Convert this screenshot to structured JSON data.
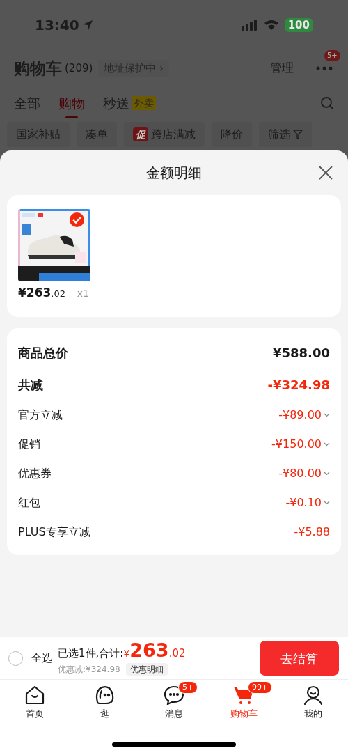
{
  "status_bar": {
    "time": "13:40",
    "battery": "100"
  },
  "header": {
    "title": "购物车",
    "count": "(209)",
    "address_badge": "地址保护中 ›",
    "manage": "管理",
    "more_badge": "5+"
  },
  "tabs": [
    {
      "label": "全部",
      "selected": false
    },
    {
      "label": "购物",
      "selected": true
    },
    {
      "label": "秒送",
      "selected": false,
      "tag": "外卖"
    }
  ],
  "filters": [
    {
      "label": "国家补贴"
    },
    {
      "label": "凑单"
    },
    {
      "label": "跨店满减",
      "tag": "促"
    },
    {
      "label": "降价"
    },
    {
      "label": "筛选",
      "kind": "filter"
    }
  ],
  "sheet": {
    "title": "金额明细",
    "products": [
      {
        "kind": "picture",
        "selected": true,
        "price_main": "¥263",
        "price_decimal": ".02",
        "quantity": "x1"
      }
    ],
    "details": [
      {
        "kind": "total",
        "label": "商品总价",
        "value": "¥588.00"
      },
      {
        "kind": "reduction_total",
        "label": "共减",
        "value": "-¥324.98"
      },
      {
        "kind": "item",
        "label": "官方立减",
        "value": "-¥89.00",
        "expandable": true
      },
      {
        "kind": "item",
        "label": "促销",
        "value": "-¥150.00",
        "expandable": true
      },
      {
        "kind": "item",
        "label": "优惠券",
        "value": "-¥80.00",
        "expandable": true
      },
      {
        "kind": "item",
        "label": "红包",
        "value": "-¥0.10",
        "expandable": true
      },
      {
        "kind": "item",
        "label": "PLUS专享立减",
        "value": "-¥5.88",
        "expandable": false
      }
    ]
  },
  "checkout": {
    "select_all": {
      "label": "全选",
      "checked": false
    },
    "summary": "已选1件,合计:",
    "currency": "¥",
    "total_main": "263",
    "total_decimal": ".02",
    "discount": "优惠减:¥324.98",
    "discount_detail": "优惠明细",
    "button": "去结算"
  },
  "nav": [
    {
      "kind": "home",
      "label": "首页",
      "selected": false
    },
    {
      "kind": "browse",
      "label": "逛",
      "selected": false
    },
    {
      "kind": "messages",
      "label": "消息",
      "selected": false,
      "badge": "5+"
    },
    {
      "kind": "cart",
      "label": "购物车",
      "selected": true,
      "badge": "99+"
    },
    {
      "kind": "profile",
      "label": "我的",
      "selected": false
    }
  ]
}
